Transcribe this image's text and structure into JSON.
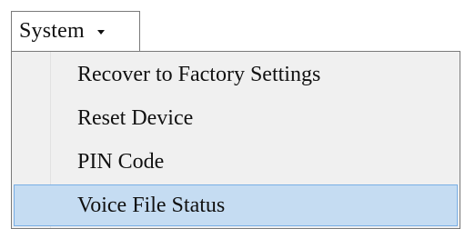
{
  "menu": {
    "title": "System",
    "items": [
      {
        "label": "Recover to Factory Settings",
        "highlighted": false
      },
      {
        "label": "Reset Device",
        "highlighted": false
      },
      {
        "label": "PIN Code",
        "highlighted": false
      },
      {
        "label": "Voice File Status",
        "highlighted": true
      }
    ]
  },
  "colors": {
    "highlight_fill": "#c5dcf2",
    "highlight_border": "#78aee5",
    "menu_background": "#f0f0f0",
    "border": "#7a7a7a"
  }
}
